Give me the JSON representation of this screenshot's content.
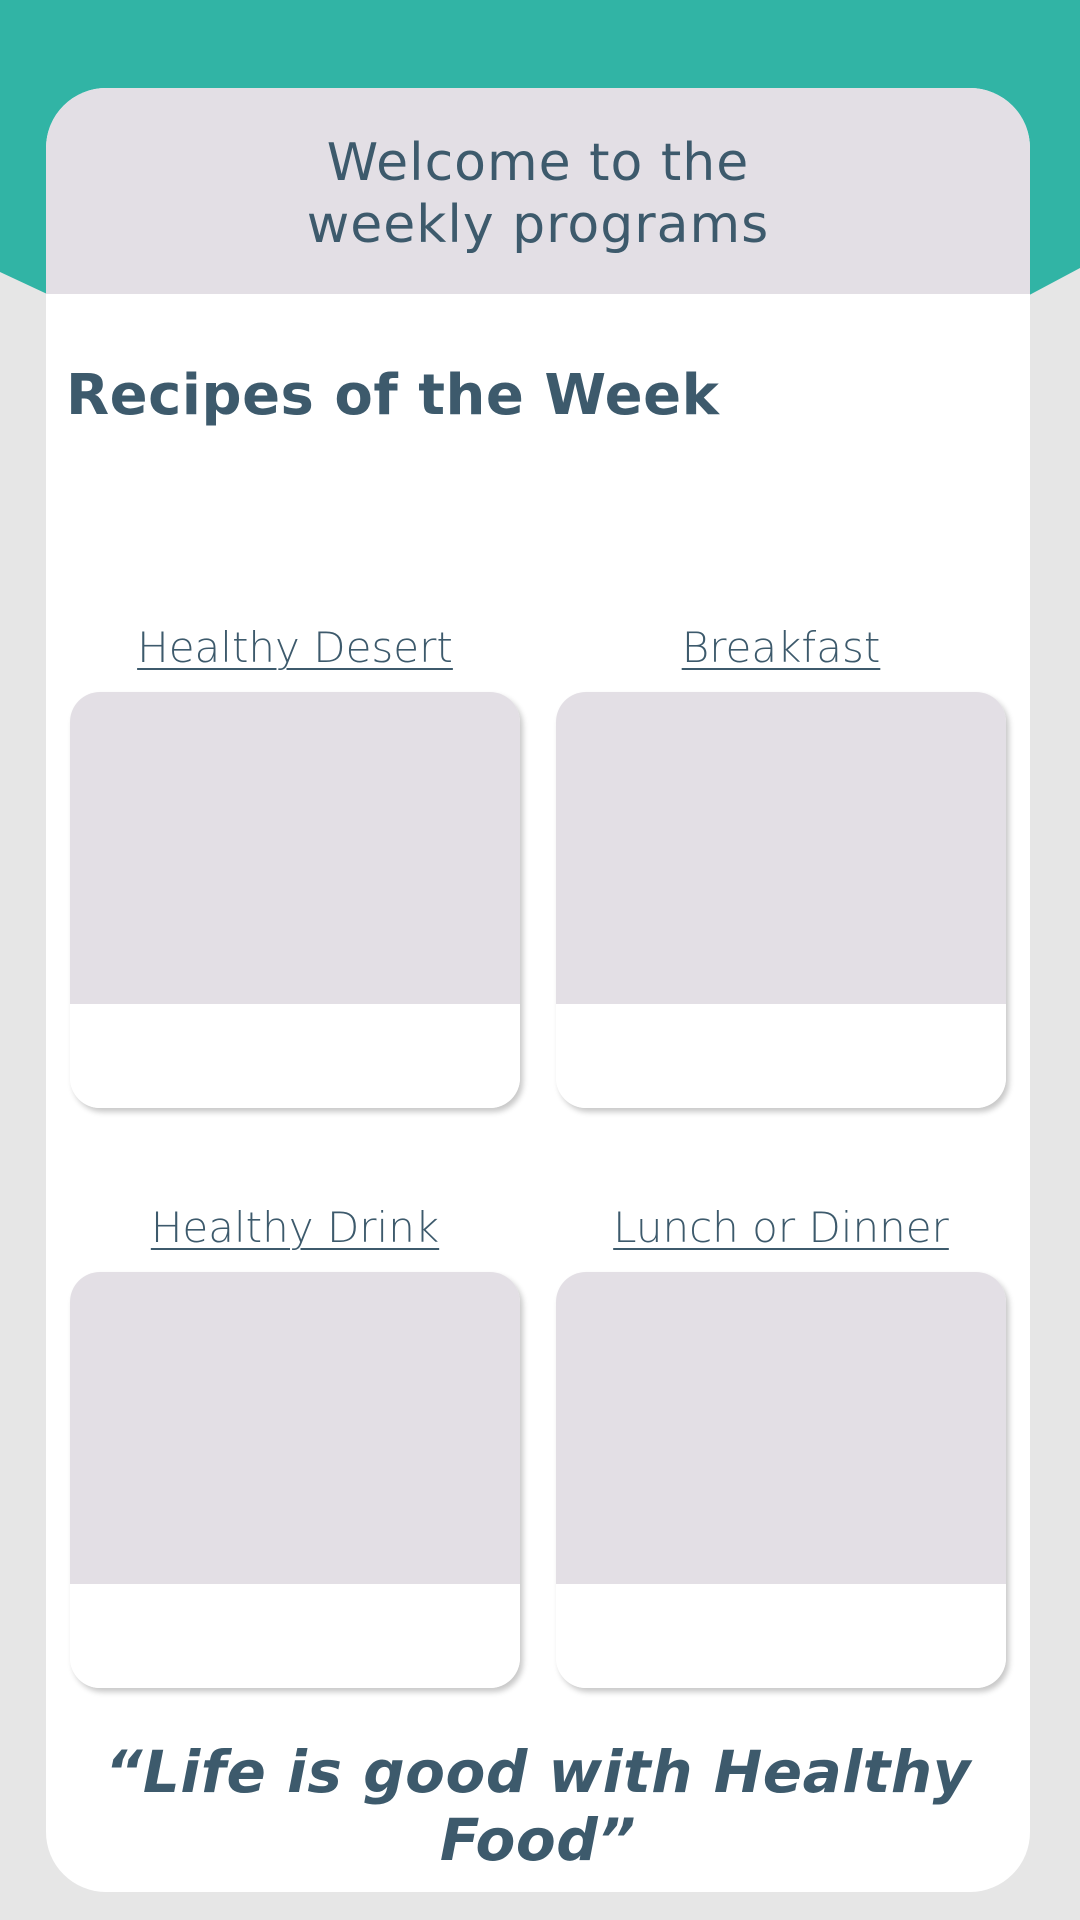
{
  "colors": {
    "teal": "#31b4a5",
    "background": "#e6e6e6",
    "card": "#ffffff",
    "placeholder": "#e3dfe5",
    "text": "#3d5a6c"
  },
  "header": {
    "welcome_line1": "Welcome to the",
    "welcome_line2": "weekly programs"
  },
  "section": {
    "title": "Recipes of the Week"
  },
  "recipes": [
    {
      "label": "Healthy Desert"
    },
    {
      "label": "Breakfast"
    },
    {
      "label": "Healthy Drink"
    },
    {
      "label": "Lunch or Dinner"
    }
  ],
  "quote": "“Life is good with Healthy Food”"
}
